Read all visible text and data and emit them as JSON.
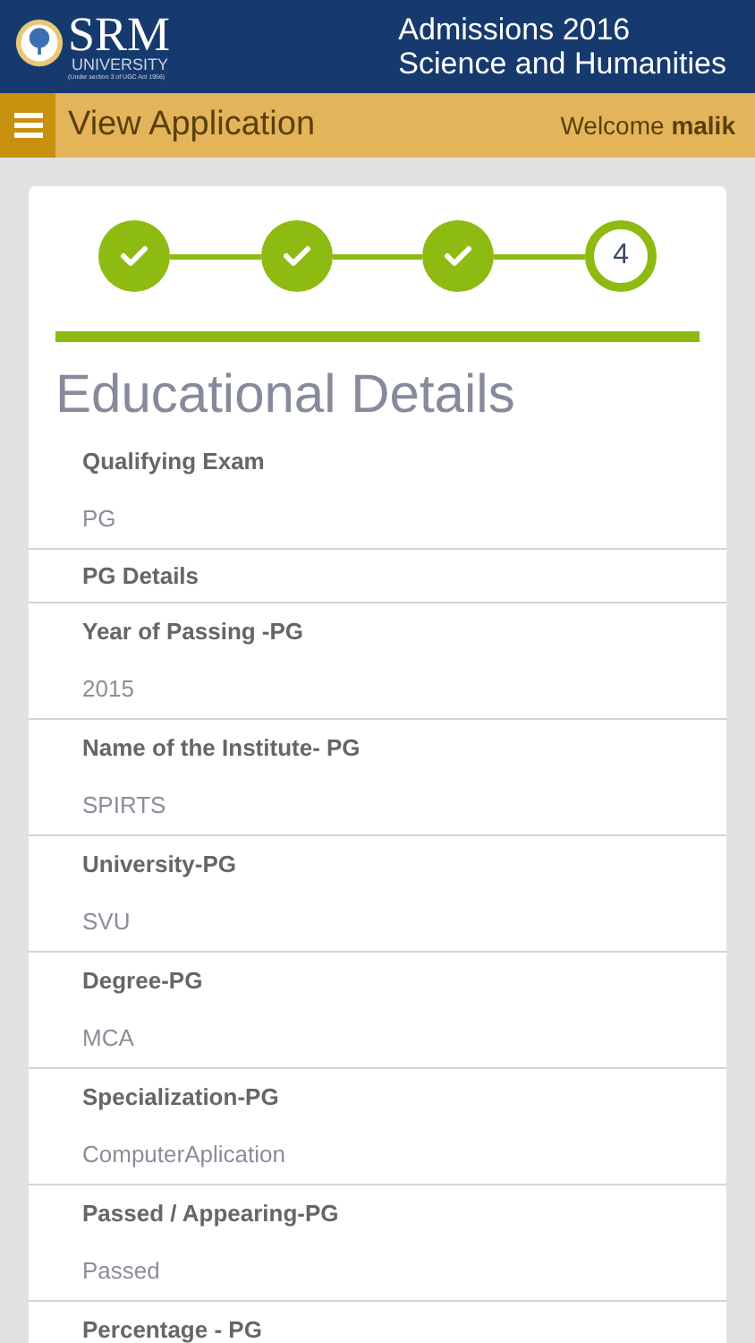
{
  "header": {
    "logo": {
      "name": "SRM",
      "sub": "UNIVERSITY",
      "note": "(Under section 3 of UGC Act 1956)"
    },
    "title_lines": [
      "Admissions 2016",
      "Science and Humanities"
    ]
  },
  "nav_bar": {
    "title": "View Application",
    "welcome": "Welcome",
    "user": "malik"
  },
  "stepper": [
    {
      "done": true
    },
    {
      "done": true
    },
    {
      "done": true
    },
    {
      "done": false,
      "number": "4"
    }
  ],
  "progress": {
    "level": 1
  },
  "section_title": "Educational Details",
  "rows": [
    {
      "kind": "field",
      "label": "Qualifying Exam",
      "value": "PG"
    },
    {
      "kind": "heading",
      "label": "PG Details"
    },
    {
      "kind": "field",
      "label": "Year of Passing -PG",
      "value": "2015"
    },
    {
      "kind": "field",
      "label": "Name of the Institute- PG",
      "value": "SPIRTS"
    },
    {
      "kind": "field",
      "label": "University-PG",
      "value": "SVU"
    },
    {
      "kind": "field",
      "label": "Degree-PG",
      "value": "MCA"
    },
    {
      "kind": "field",
      "label": "Specialization-PG",
      "value": "ComputerAplication"
    },
    {
      "kind": "field",
      "label": "Passed / Appearing-PG",
      "value": "Passed"
    },
    {
      "kind": "field",
      "label": "Percentage - PG"
    }
  ]
}
